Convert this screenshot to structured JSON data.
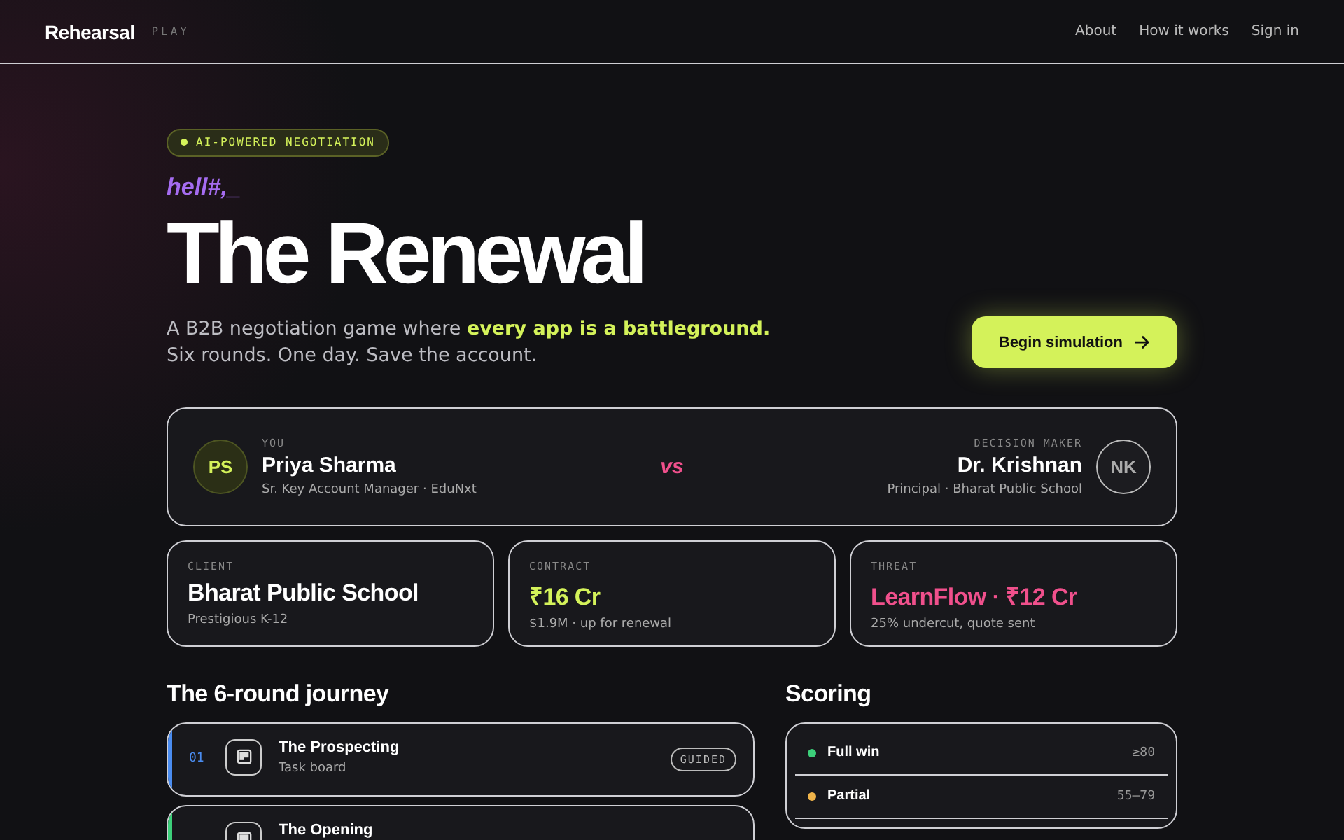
{
  "nav": {
    "brand": "Rehearsal",
    "tag": "PLAY",
    "links": [
      "About",
      "How it works",
      "Sign in"
    ]
  },
  "hero": {
    "badge": "AI-POWERED NEGOTIATION",
    "typing": "hell#,_",
    "title": "The Renewal",
    "lead": "A B2B negotiation game where **every app is a battleground.**",
    "lead2": "Six rounds. One day. Save the account.",
    "cta": "Begin simulation"
  },
  "matchup": {
    "you": {
      "initials": "PS",
      "role": "YOU",
      "name": "Priya Sharma",
      "detail": "Sr. Key Account Manager · EduNxt"
    },
    "vs": "vs",
    "them": {
      "initials": "NK",
      "role": "DECISION MAKER",
      "name": "Dr. Krishnan",
      "detail": "Principal · Bharat Public School"
    }
  },
  "stats": [
    {
      "label": "CLIENT",
      "value": "Bharat Public School",
      "note": "Prestigious K-12",
      "color": "#ffffff"
    },
    {
      "label": "CONTRACT",
      "value": "₹16 Cr",
      "note": "$1.9M · up for renewal",
      "color": "#d4f25a"
    },
    {
      "label": "THREAT",
      "value": "LearnFlow · ₹12 Cr",
      "note": "25% undercut, quote sent",
      "color": "#f0508c"
    }
  ],
  "journey": {
    "heading": "The 6-round journey",
    "rounds": [
      {
        "number": "01",
        "title": "The Prospecting",
        "subtitle": "Task board",
        "badge": "GUIDED",
        "color": "#4a8cf0"
      },
      {
        "title": "The Opening",
        "color": "#3ccf7a"
      }
    ]
  },
  "scoring": {
    "heading": "Scoring",
    "rows": [
      {
        "label": "Full win",
        "range": "≥80",
        "color": "#3ccf7a"
      },
      {
        "label": "Partial",
        "range": "55–79",
        "color": "#f0b44a"
      }
    ]
  }
}
